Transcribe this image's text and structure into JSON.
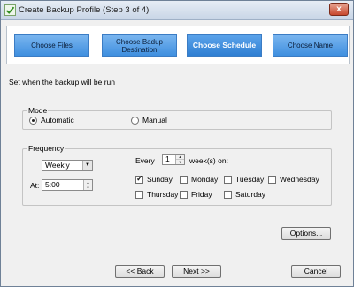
{
  "window": {
    "title": "Create Backup Profile (Step 3 of 4)",
    "close": "x"
  },
  "steps": [
    "Choose Files",
    "Choose Badup Destination",
    "Choose Schedule",
    "Choose Name"
  ],
  "active_step": "Choose Schedule",
  "instruction": "Set when the backup will be run",
  "mode": {
    "label": "Mode",
    "automatic": "Automatic",
    "manual": "Manual",
    "selected": "Automatic"
  },
  "frequency": {
    "label": "Frequency",
    "interval": "Weekly",
    "at_label": "At:",
    "time": "5:00",
    "every_label": "Every",
    "every_value": "1",
    "weeks_label": "week(s) on:",
    "days": [
      {
        "name": "Sunday",
        "checked": true
      },
      {
        "name": "Monday",
        "checked": false
      },
      {
        "name": "Tuesday",
        "checked": false
      },
      {
        "name": "Wednesday",
        "checked": false
      },
      {
        "name": "Thursday",
        "checked": false
      },
      {
        "name": "Friday",
        "checked": false
      },
      {
        "name": "Saturday",
        "checked": false
      }
    ]
  },
  "buttons": {
    "options": "Options...",
    "back": "<< Back",
    "next": "Next >>",
    "cancel": "Cancel"
  }
}
